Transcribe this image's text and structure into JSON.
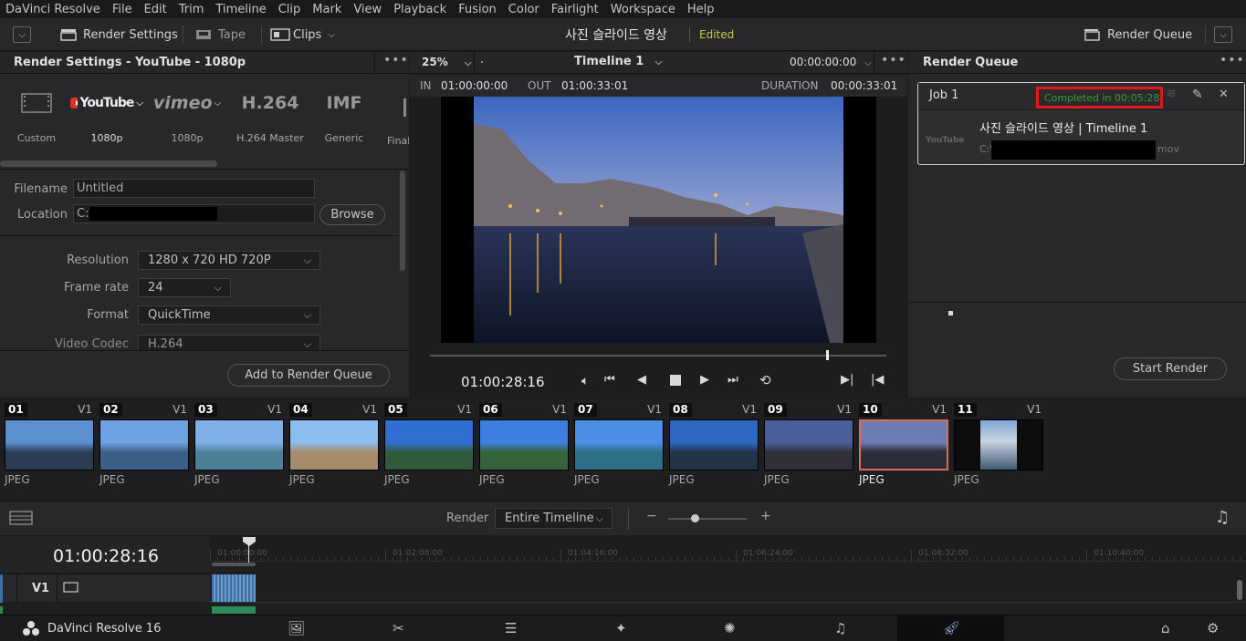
{
  "menu": [
    "DaVinci Resolve",
    "File",
    "Edit",
    "Trim",
    "Timeline",
    "Clip",
    "Mark",
    "View",
    "Playback",
    "Fusion",
    "Color",
    "Fairlight",
    "Workspace",
    "Help"
  ],
  "toolbar": {
    "render_settings": "Render Settings",
    "tape": "Tape",
    "clips": "Clips",
    "project_title": "사진 슬라이드 영상",
    "edited_status": "Edited",
    "render_queue": "Render Queue"
  },
  "render_settings": {
    "header": "Render Settings - YouTube - 1080p",
    "presets": [
      {
        "icon": "film-strip-icon",
        "label": "Custom"
      },
      {
        "icon": "youtube-logo",
        "logo_text": "YouTube",
        "label": "1080p"
      },
      {
        "icon": "vimeo-logo",
        "logo_text": "vimeo",
        "label": "1080p"
      },
      {
        "icon": "h264-icon",
        "logo_text": "H.264",
        "label": "H.264 Master"
      },
      {
        "icon": "imf-icon",
        "logo_text": "IMF",
        "label": "Generic"
      },
      {
        "icon": "final-icon",
        "label": "Final"
      }
    ],
    "filename_label": "Filename",
    "filename_value": "Untitled",
    "location_label": "Location",
    "location_value": "C:\\",
    "browse_label": "Browse",
    "resolution_label": "Resolution",
    "resolution_value": "1280 x 720 HD 720P",
    "framerate_label": "Frame rate",
    "framerate_value": "24",
    "format_label": "Format",
    "format_value": "QuickTime",
    "codec_label": "Video Codec",
    "codec_value": "H.264",
    "add_to_queue": "Add to Render Queue"
  },
  "viewer": {
    "zoom": "25%",
    "timeline_name": "Timeline 1",
    "timecode_top": "00:00:00:00",
    "in_label": "IN",
    "in_value": "01:00:00:00",
    "out_label": "OUT",
    "out_value": "01:00:33:01",
    "duration_label": "DURATION",
    "duration_value": "00:00:33:01",
    "current_timecode": "01:00:28:16",
    "scrub_position": 0.87
  },
  "render_queue": {
    "header": "Render Queue",
    "job_name": "Job 1",
    "job_status": "Completed in 00:05:28",
    "job_title": "사진 슬라이드 영상 | Timeline 1",
    "job_path_prefix": "C:\\",
    "job_path_suffix": "mov",
    "job_logo": "YouTube",
    "start_render": "Start Render"
  },
  "clips": [
    {
      "num": "01",
      "track": "V1",
      "type": "JPEG",
      "sky": "#5a8fd0",
      "ground": "#2c3c55"
    },
    {
      "num": "02",
      "track": "V1",
      "type": "JPEG",
      "sky": "#6fa2e2",
      "ground": "#3b5f86"
    },
    {
      "num": "03",
      "track": "V1",
      "type": "JPEG",
      "sky": "#7fb0e8",
      "ground": "#4d7f96"
    },
    {
      "num": "04",
      "track": "V1",
      "type": "JPEG",
      "sky": "#8cbdf0",
      "ground": "#a58b6a"
    },
    {
      "num": "05",
      "track": "V1",
      "type": "JPEG",
      "sky": "#2f6fd2",
      "ground": "#2f5b3b"
    },
    {
      "num": "06",
      "track": "V1",
      "type": "JPEG",
      "sky": "#3c7fe0",
      "ground": "#35633b"
    },
    {
      "num": "07",
      "track": "V1",
      "type": "JPEG",
      "sky": "#4c8ee6",
      "ground": "#2d6f86"
    },
    {
      "num": "08",
      "track": "V1",
      "type": "JPEG",
      "sky": "#2e66c4",
      "ground": "#233345"
    },
    {
      "num": "09",
      "track": "V1",
      "type": "JPEG",
      "sky": "#4a5f9a",
      "ground": "#30303a"
    },
    {
      "num": "10",
      "track": "V1",
      "type": "JPEG",
      "sky": "#6a7cb0",
      "ground": "#2b2d38",
      "selected": true
    },
    {
      "num": "11",
      "track": "V1",
      "type": "JPEG",
      "sky": "#7ea6d6",
      "ground": "#3a5470"
    }
  ],
  "timeline_bar": {
    "render_label": "Render",
    "render_value": "Entire Timeline"
  },
  "timeline": {
    "timecode": "01:00:28:16",
    "ruler": [
      "01:00:00:00",
      "01:02:08:00",
      "01:04:16:00",
      "01:06:24:00",
      "01:08:32:00",
      "01:10:40:00"
    ],
    "track": "V1"
  },
  "pagebar": {
    "app_name": "DaVinci Resolve 16"
  },
  "colors": {
    "accent_green": "#3a9a3a",
    "highlight_red": "#e01818",
    "edited_yellow": "#c8c84c",
    "selected_clip": "#e06a5c"
  }
}
